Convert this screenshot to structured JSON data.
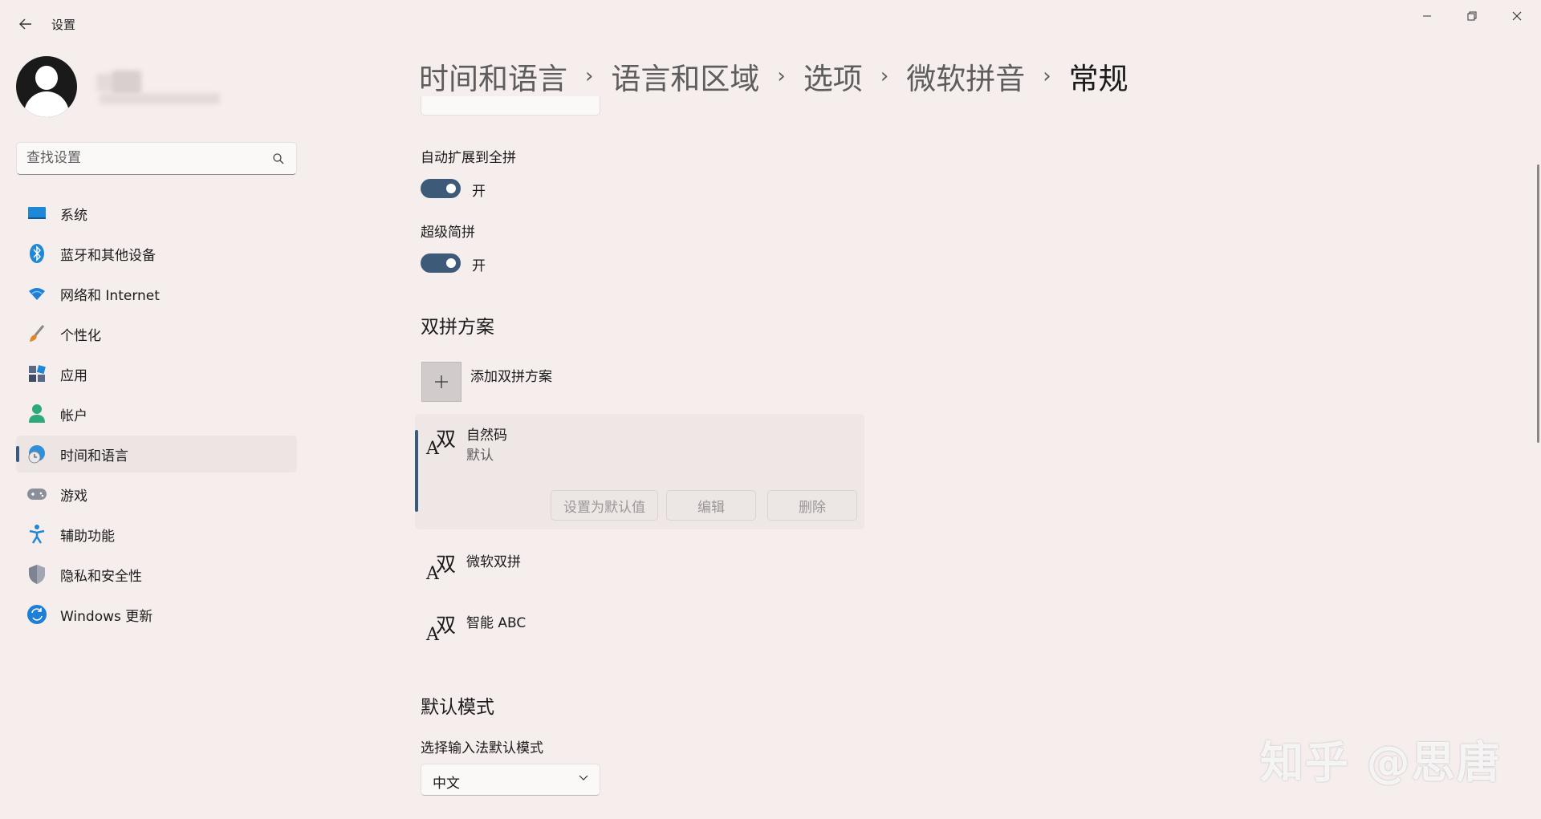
{
  "titlebar": {
    "title": "设置",
    "back_icon": "arrow-left-icon",
    "controls": [
      "minimize-icon",
      "restore-icon",
      "close-icon"
    ]
  },
  "search": {
    "placeholder": "查找设置",
    "value": ""
  },
  "nav": {
    "items": [
      {
        "label": "系统",
        "icon": "monitor-icon",
        "color": "#1e88d6"
      },
      {
        "label": "蓝牙和其他设备",
        "icon": "bluetooth-icon",
        "color": "#1e88d6"
      },
      {
        "label": "网络和 Internet",
        "icon": "wifi-icon",
        "color": "#1e7fd6"
      },
      {
        "label": "个性化",
        "icon": "brush-icon",
        "color": "#e0872c"
      },
      {
        "label": "应用",
        "icon": "apps-icon",
        "color": "#5b6a84"
      },
      {
        "label": "帐户",
        "icon": "account-icon",
        "color": "#2ea97c"
      },
      {
        "label": "时间和语言",
        "icon": "globe-clock-icon",
        "color": "#2f8fd9",
        "active": true
      },
      {
        "label": "游戏",
        "icon": "gamepad-icon",
        "color": "#8a8f99"
      },
      {
        "label": "辅助功能",
        "icon": "accessibility-icon",
        "color": "#1e88d6"
      },
      {
        "label": "隐私和安全性",
        "icon": "shield-icon",
        "color": "#7d8391"
      },
      {
        "label": "Windows 更新",
        "icon": "update-icon",
        "color": "#1e7fd6"
      }
    ]
  },
  "breadcrumb": [
    "时间和语言",
    "语言和区域",
    "选项",
    "微软拼音",
    "常规"
  ],
  "settings": {
    "auto_expand": {
      "label": "自动扩展到全拼",
      "state": "开",
      "on": true
    },
    "super_jianpin": {
      "label": "超级简拼",
      "state": "开",
      "on": true
    }
  },
  "shuangpin": {
    "section_title": "双拼方案",
    "add_label": "添加双拼方案",
    "schemes": [
      {
        "name": "自然码",
        "sub": "默认",
        "selected": true
      },
      {
        "name": "微软双拼"
      },
      {
        "name": "智能 ABC"
      }
    ],
    "buttons": {
      "set_default": "设置为默认值",
      "edit": "编辑",
      "delete": "删除"
    }
  },
  "default_mode": {
    "section_title": "默认模式",
    "label": "选择输入法默认模式",
    "value": "中文"
  },
  "watermark": "知乎 @思唐",
  "colors": {
    "accent": "#3d5b78",
    "background": "#f6eeed"
  }
}
